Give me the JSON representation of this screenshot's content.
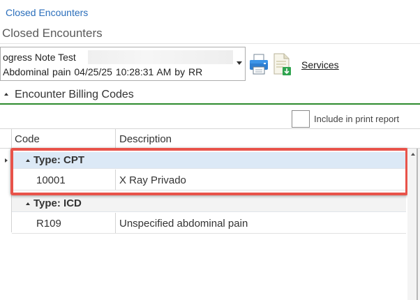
{
  "breadcrumb": "Closed Encounters",
  "page_title": "Closed Encounters",
  "encounter": {
    "line1": "ogress Note Test",
    "line2": "Abdominal pain   04/25/25 10:28:31 AM by RR"
  },
  "toolbar": {
    "print_icon": "printer-icon",
    "export_icon": "document-download-icon",
    "services_label": "Services"
  },
  "section": {
    "title": "Encounter Billing Codes"
  },
  "print_option": {
    "label": "Include in print report",
    "checked": false
  },
  "grid": {
    "columns": [
      "Code",
      "Description"
    ],
    "groups": [
      {
        "label": "Type: CPT",
        "rows": [
          {
            "code": "10001",
            "description": "X Ray Privado"
          }
        ]
      },
      {
        "label": "Type: ICD",
        "rows": [
          {
            "code": "R109",
            "description": "Unspecified abdominal pain"
          }
        ]
      }
    ]
  },
  "colors": {
    "link": "#2a6ebb",
    "section_rule": "#2e8b2e",
    "highlight_border": "#e8534a",
    "selected_group": "#dce9f6"
  }
}
